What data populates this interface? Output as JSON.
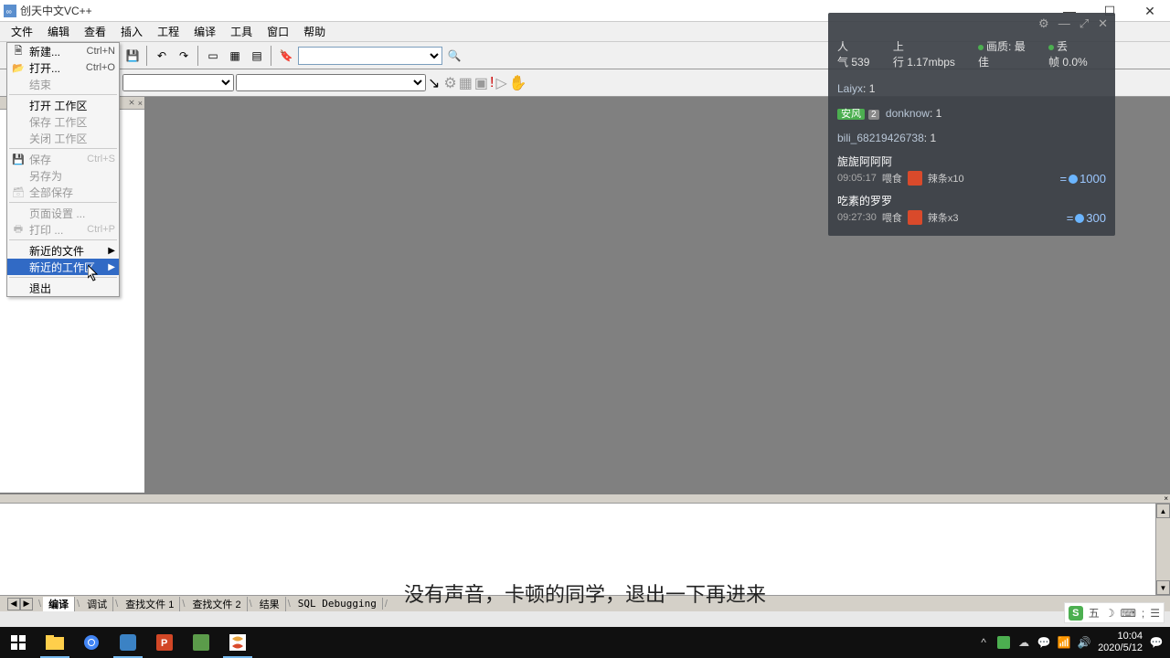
{
  "title": "创天中文VC++",
  "menubar": [
    "文件",
    "编辑",
    "查看",
    "插入",
    "工程",
    "编译",
    "工具",
    "窗口",
    "帮助"
  ],
  "filemenu": {
    "new": {
      "label": "新建...",
      "shortcut": "Ctrl+N"
    },
    "open": {
      "label": "打开...",
      "shortcut": "Ctrl+O"
    },
    "end": {
      "label": "结束"
    },
    "openws": {
      "label": "打开 工作区"
    },
    "savews": {
      "label": "保存 工作区"
    },
    "closews": {
      "label": "关闭 工作区"
    },
    "save": {
      "label": "保存",
      "shortcut": "Ctrl+S"
    },
    "saveas": {
      "label": "另存为"
    },
    "saveall": {
      "label": "全部保存"
    },
    "pagesetup": {
      "label": "页面设置 ..."
    },
    "print": {
      "label": "打印 ...",
      "shortcut": "Ctrl+P"
    },
    "recentfiles": {
      "label": "新近的文件"
    },
    "recentws": {
      "label": "新近的工作区"
    },
    "exit": {
      "label": "退出"
    }
  },
  "output_tabs": {
    "nav": [
      "◀",
      "▶"
    ],
    "active": "编译",
    "tabs": [
      "编译",
      "调试",
      "查找文件 1",
      "查找文件 2",
      "结果",
      "SQL Debugging"
    ]
  },
  "subtitle": "没有声音，卡顿的同学，退出一下再进来",
  "ime": {
    "icon": "S",
    "label": "五",
    "extras": [
      "☽",
      "⌨",
      ";",
      "☰"
    ]
  },
  "overlay": {
    "controls": [
      "⚙",
      "—",
      "⤢",
      "✕"
    ],
    "stats": {
      "pop_label": "人气",
      "pop_value": "539",
      "up_label": "上行",
      "up_value": "1.17mbps",
      "quality_label": "画质:",
      "quality_value": "最佳",
      "drop_label": "丢帧",
      "drop_value": "0.0%"
    },
    "messages": [
      {
        "name": "Laiyx",
        "text": "1"
      },
      {
        "badge": "安风",
        "lvl": "2",
        "name": "donknow",
        "text": "1"
      },
      {
        "name": "bili_68219426738",
        "text": "1"
      }
    ],
    "gifts": [
      {
        "user": "旎旎阿阿阿",
        "time": "09:05:17",
        "action": "喂食",
        "item": "辣条x10",
        "value": "1000"
      },
      {
        "user": "吃素的罗罗",
        "time": "09:27:30",
        "action": "喂食",
        "item": "辣条x3",
        "value": "300"
      }
    ]
  },
  "taskbar": {
    "time": "10:04",
    "date": "2020/5/12"
  }
}
